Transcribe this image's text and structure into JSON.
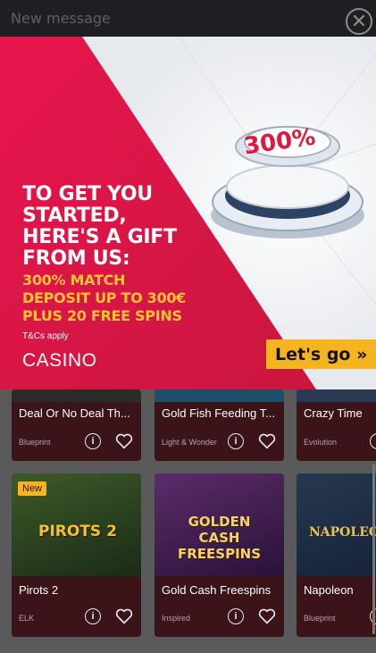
{
  "header": {
    "title": "New message",
    "close_glyph": "✕"
  },
  "promo": {
    "headline": "TO GET YOU\nSTARTED,\nHERE'S A GIFT\nFROM US:",
    "offer": "300% MATCH\nDEPOSIT UP TO 300€\nPLUS 20 FREE SPINS",
    "tcs": "T&Cs apply",
    "brand": "CASINO",
    "cta_label": "Let's go »",
    "badge_text": "300%",
    "colors": {
      "red": "#e1184a",
      "yellow": "#f6b51f",
      "offer": "#ffc23a"
    }
  },
  "games": [
    {
      "name": "Deal Or No Deal Th...",
      "provider": "Blueprint",
      "info_icon": "info-icon",
      "fav_icon": "heart-icon"
    },
    {
      "name": "Gold Fish Feeding T...",
      "provider": "Light & Wonder",
      "info_icon": "info-icon",
      "fav_icon": "heart-icon"
    },
    {
      "name": "Crazy Time",
      "provider": "Evolution",
      "info_icon": "info-icon",
      "fav_icon": "heart-icon"
    },
    {
      "name": "Pirots 2",
      "provider": "ELK",
      "badge": "New",
      "art_text": "PIROTS 2",
      "info_icon": "info-icon",
      "fav_icon": "heart-icon"
    },
    {
      "name": "Gold Cash Freespins",
      "provider": "Inspired",
      "art_text": "GOLDEN CASH FREESPINS",
      "info_icon": "info-icon",
      "fav_icon": "heart-icon"
    },
    {
      "name": "Napoleon",
      "provider": "Blueprint",
      "art_text": "NAPOLEON",
      "info_icon": "info-icon",
      "fav_icon": "heart-icon"
    }
  ]
}
